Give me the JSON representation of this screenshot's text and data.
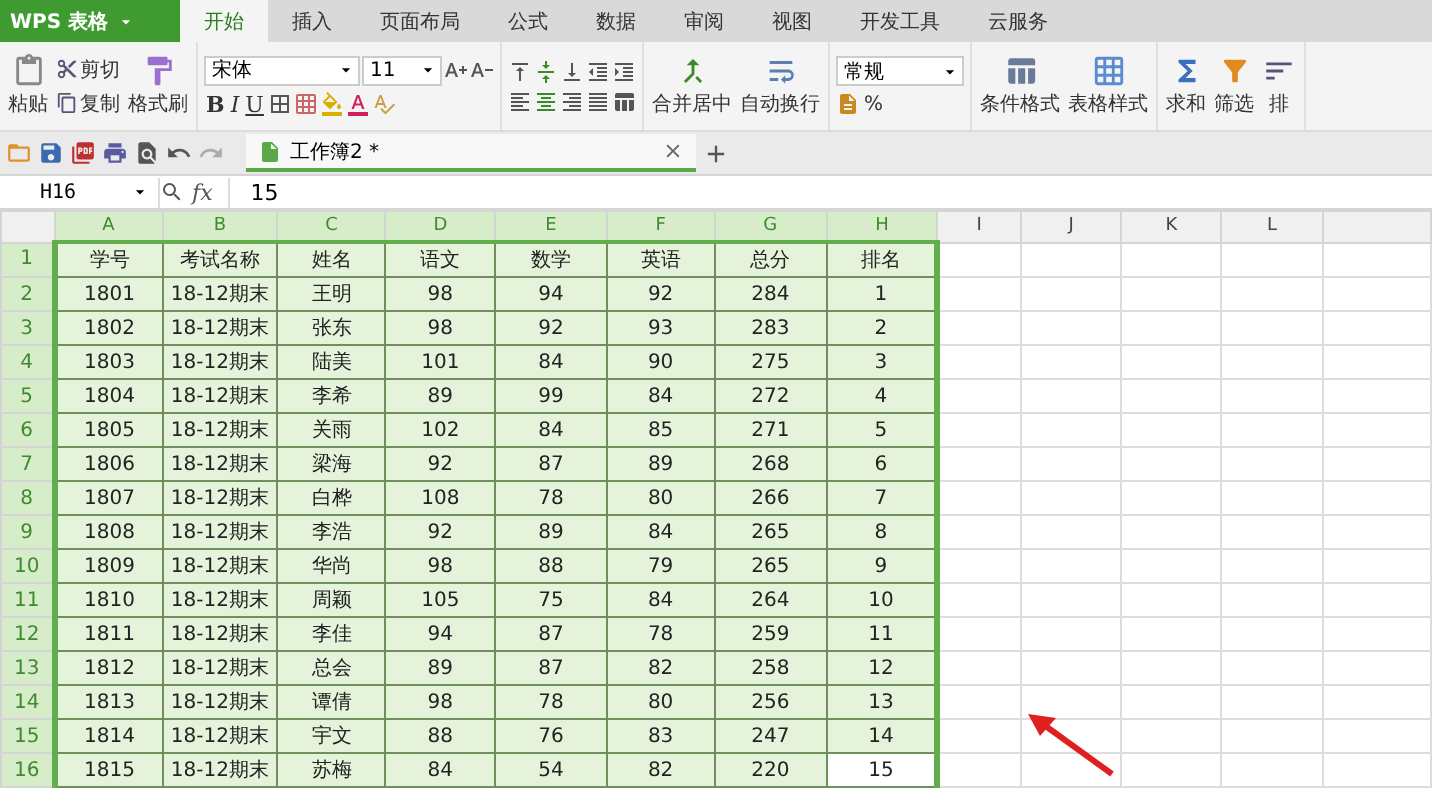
{
  "app_menu": {
    "label": "WPS 表格"
  },
  "menu_tabs": [
    {
      "label": "开始",
      "selected": true
    },
    {
      "label": "插入",
      "selected": false
    },
    {
      "label": "页面布局",
      "selected": false
    },
    {
      "label": "公式",
      "selected": false
    },
    {
      "label": "数据",
      "selected": false
    },
    {
      "label": "审阅",
      "selected": false
    },
    {
      "label": "视图",
      "selected": false
    },
    {
      "label": "开发工具",
      "selected": false
    },
    {
      "label": "云服务",
      "selected": false
    }
  ],
  "ribbon": {
    "clipboard": {
      "paste": "粘贴",
      "cut": "剪切",
      "copy": "复制",
      "format_painter": "格式刷"
    },
    "font": {
      "name": "宋体",
      "size": "11",
      "bold": "B",
      "italic": "I",
      "underline": "U"
    },
    "merge": {
      "merge_center": "合并居中",
      "wrap_text": "自动换行"
    },
    "number": {
      "format": "常规",
      "percent": "%"
    },
    "styles": {
      "conditional": "条件格式",
      "table_style": "表格样式"
    },
    "editing": {
      "sum": "求和",
      "filter": "筛选",
      "sort": "排"
    }
  },
  "document_tabs": [
    {
      "label": "工作簿2 *",
      "selected": true
    }
  ],
  "formula_bar": {
    "cell_ref": "H16",
    "function_label": "fx",
    "value": "15"
  },
  "sheet": {
    "columns": [
      {
        "label": "A",
        "selected": true
      },
      {
        "label": "B",
        "selected": true
      },
      {
        "label": "C",
        "selected": true
      },
      {
        "label": "D",
        "selected": true
      },
      {
        "label": "E",
        "selected": true
      },
      {
        "label": "F",
        "selected": true
      },
      {
        "label": "G",
        "selected": true
      },
      {
        "label": "H",
        "selected": true
      },
      {
        "label": "I",
        "selected": false
      },
      {
        "label": "J",
        "selected": false
      },
      {
        "label": "K",
        "selected": false
      },
      {
        "label": "L",
        "selected": false
      }
    ],
    "rows": [
      {
        "header": "1",
        "selected": true,
        "cells": [
          "学号",
          "考试名称",
          "姓名",
          "语文",
          "数学",
          "英语",
          "总分",
          "排名"
        ]
      },
      {
        "header": "2",
        "selected": true,
        "cells": [
          "1801",
          "18-12期末",
          "王明",
          "98",
          "94",
          "92",
          "284",
          "1"
        ]
      },
      {
        "header": "3",
        "selected": true,
        "cells": [
          "1802",
          "18-12期末",
          "张东",
          "98",
          "92",
          "93",
          "283",
          "2"
        ]
      },
      {
        "header": "4",
        "selected": true,
        "cells": [
          "1803",
          "18-12期末",
          "陆美",
          "101",
          "84",
          "90",
          "275",
          "3"
        ]
      },
      {
        "header": "5",
        "selected": true,
        "cells": [
          "1804",
          "18-12期末",
          "李希",
          "89",
          "99",
          "84",
          "272",
          "4"
        ]
      },
      {
        "header": "6",
        "selected": true,
        "cells": [
          "1805",
          "18-12期末",
          "关雨",
          "102",
          "84",
          "85",
          "271",
          "5"
        ]
      },
      {
        "header": "7",
        "selected": true,
        "cells": [
          "1806",
          "18-12期末",
          "梁海",
          "92",
          "87",
          "89",
          "268",
          "6"
        ]
      },
      {
        "header": "8",
        "selected": true,
        "cells": [
          "1807",
          "18-12期末",
          "白桦",
          "108",
          "78",
          "80",
          "266",
          "7"
        ]
      },
      {
        "header": "9",
        "selected": true,
        "cells": [
          "1808",
          "18-12期末",
          "李浩",
          "92",
          "89",
          "84",
          "265",
          "8"
        ]
      },
      {
        "header": "10",
        "selected": true,
        "cells": [
          "1809",
          "18-12期末",
          "华尚",
          "98",
          "88",
          "79",
          "265",
          "9"
        ]
      },
      {
        "header": "11",
        "selected": true,
        "cells": [
          "1810",
          "18-12期末",
          "周颖",
          "105",
          "75",
          "84",
          "264",
          "10"
        ]
      },
      {
        "header": "12",
        "selected": true,
        "cells": [
          "1811",
          "18-12期末",
          "李佳",
          "94",
          "87",
          "78",
          "259",
          "11"
        ]
      },
      {
        "header": "13",
        "selected": true,
        "cells": [
          "1812",
          "18-12期末",
          "总会",
          "89",
          "87",
          "82",
          "258",
          "12"
        ]
      },
      {
        "header": "14",
        "selected": true,
        "cells": [
          "1813",
          "18-12期末",
          "谭倩",
          "98",
          "78",
          "80",
          "256",
          "13"
        ]
      },
      {
        "header": "15",
        "selected": true,
        "cells": [
          "1814",
          "18-12期末",
          "宇文",
          "88",
          "76",
          "83",
          "247",
          "14"
        ]
      },
      {
        "header": "16",
        "selected": true,
        "cells": [
          "1815",
          "18-12期末",
          "苏梅",
          "84",
          "54",
          "82",
          "220",
          {
            "text": "15",
            "active": true
          }
        ]
      }
    ]
  }
}
